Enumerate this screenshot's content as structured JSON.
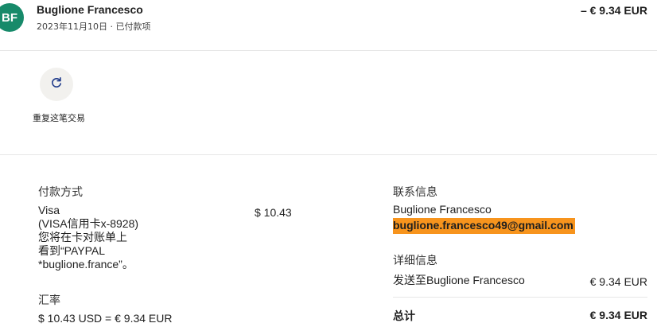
{
  "header": {
    "avatar_initials": "BF",
    "avatar_color": "#178a6a",
    "merchant_name": "Buglione Francesco",
    "date": "2023年11月10日",
    "separator": "·",
    "status": "已付款项",
    "amount": "– € 9.34 EUR"
  },
  "actions": {
    "repeat_icon": "refresh-icon",
    "repeat_label": "重复这笔交易"
  },
  "payment_method": {
    "title": "付款方式",
    "lines": [
      "Visa",
      "(VISA信用卡x-8928)",
      "您将在卡对账单上",
      "看到“PAYPAL",
      "*buglione.france”。"
    ],
    "amount": "$ 10.43"
  },
  "exchange_rate": {
    "title": "汇率",
    "value": "$ 10.43 USD = € 9.34 EUR"
  },
  "contact": {
    "title": "联系信息",
    "name": "Buglione Francesco",
    "email": "buglione.francesco49@gmail.com",
    "highlight_color": "#f7941d"
  },
  "details": {
    "title": "详细信息",
    "sent_to": "发送至Buglione Francesco",
    "sent_amount": "€ 9.34 EUR",
    "total_label": "总计",
    "total_amount": "€ 9.34 EUR"
  }
}
